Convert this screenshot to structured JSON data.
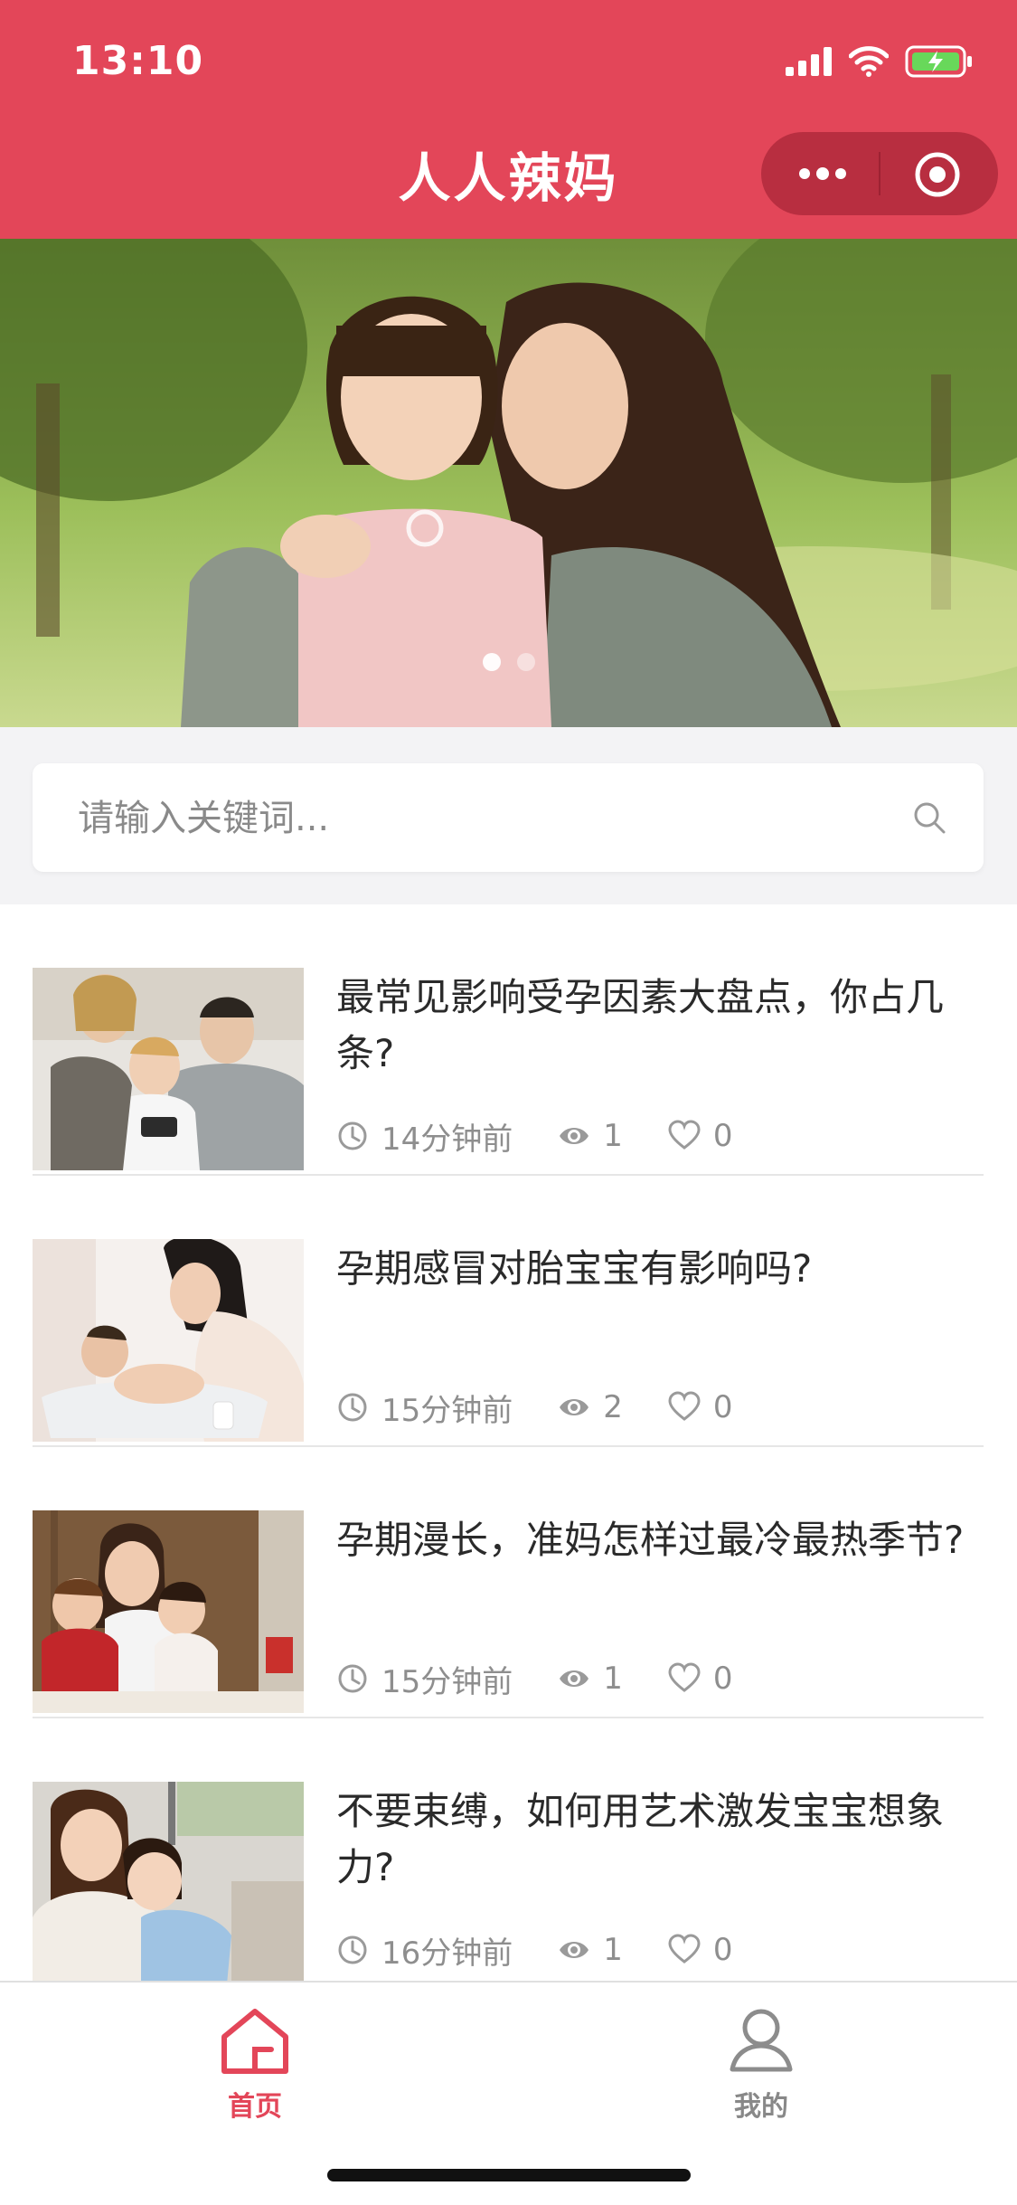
{
  "status_bar": {
    "time": "13:10"
  },
  "header": {
    "title": "人人辣妈"
  },
  "capsule": {
    "more_icon": "more-dots-icon",
    "close_icon": "target-icon"
  },
  "banner": {
    "active_index": 0,
    "count": 2
  },
  "search": {
    "placeholder": "请输入关键词...",
    "icon": "search-icon"
  },
  "articles": [
    {
      "title": "最常见影响受孕因素大盘点，你占几条?",
      "time": "14分钟前",
      "views": "1",
      "likes": "0"
    },
    {
      "title": "孕期感冒对胎宝宝有影响吗?",
      "time": "15分钟前",
      "views": "2",
      "likes": "0"
    },
    {
      "title": "孕期漫长，准妈怎样过最冷最热季节?",
      "time": "15分钟前",
      "views": "1",
      "likes": "0"
    },
    {
      "title": "不要束缚，如何用艺术激发宝宝想象力?",
      "time": "16分钟前",
      "views": "1",
      "likes": "0"
    }
  ],
  "tabbar": {
    "tabs": [
      {
        "label": "首页",
        "icon": "home-icon",
        "active": true
      },
      {
        "label": "我的",
        "icon": "user-icon",
        "active": false
      }
    ]
  },
  "colors": {
    "brand": "#e34659",
    "active_tab": "#e34659",
    "inactive_tab": "#888888"
  }
}
